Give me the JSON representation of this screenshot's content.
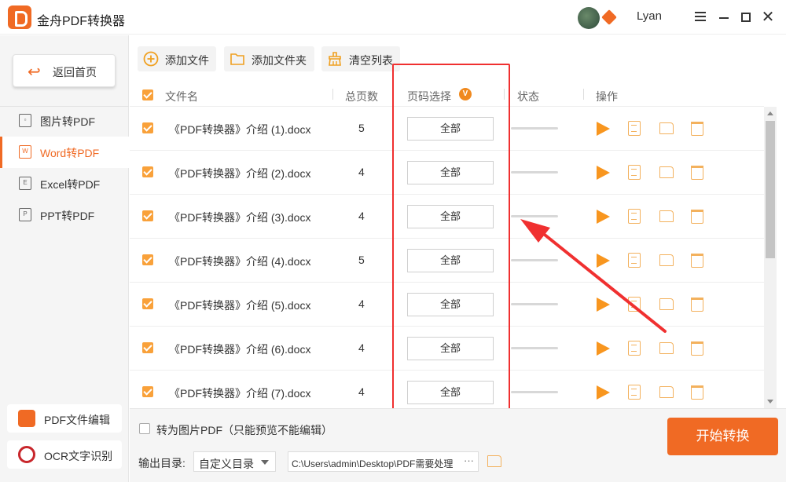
{
  "app": {
    "title": "金舟PDF转换器",
    "username": "Lyan",
    "accent_color": "#f06a24",
    "window_controls": [
      "menu-icon",
      "minimize-icon",
      "maximize-icon",
      "close-icon"
    ]
  },
  "sidebar": {
    "back_label": "返回首页",
    "items": [
      {
        "label": "图片转PDF",
        "icon": "image-file-icon",
        "icon_text": "",
        "active": false
      },
      {
        "label": "Word转PDF",
        "icon": "word-file-icon",
        "icon_text": "W",
        "active": true
      },
      {
        "label": "Excel转PDF",
        "icon": "excel-file-icon",
        "icon_text": "E",
        "active": false
      },
      {
        "label": "PPT转PDF",
        "icon": "ppt-file-icon",
        "icon_text": "P",
        "active": false
      }
    ],
    "tools": [
      {
        "label": "PDF文件编辑",
        "icon": "pdf-edit-icon"
      },
      {
        "label": "OCR文字识别",
        "icon": "ocr-eye-icon"
      }
    ]
  },
  "toolbar": {
    "add_file": "添加文件",
    "add_folder": "添加文件夹",
    "clear_list": "清空列表"
  },
  "table": {
    "headers": {
      "filename": "文件名",
      "pages": "总页数",
      "page_range": "页码选择",
      "page_range_badge": "V",
      "status": "状态",
      "actions": "操作"
    },
    "rows": [
      {
        "checked": true,
        "filename": "《PDF转换器》介绍 (1).docx",
        "pages": "5",
        "range": "全部"
      },
      {
        "checked": true,
        "filename": "《PDF转换器》介绍 (2).docx",
        "pages": "4",
        "range": "全部"
      },
      {
        "checked": true,
        "filename": "《PDF转换器》介绍 (3).docx",
        "pages": "4",
        "range": "全部"
      },
      {
        "checked": true,
        "filename": "《PDF转换器》介绍 (4).docx",
        "pages": "5",
        "range": "全部"
      },
      {
        "checked": true,
        "filename": "《PDF转换器》介绍 (5).docx",
        "pages": "4",
        "range": "全部"
      },
      {
        "checked": true,
        "filename": "《PDF转换器》介绍 (6).docx",
        "pages": "4",
        "range": "全部"
      },
      {
        "checked": true,
        "filename": "《PDF转换器》介绍 (7).docx",
        "pages": "4",
        "range": "全部"
      }
    ]
  },
  "bottom": {
    "convert_to_image_label": "转为图片PDF（只能预览不能编辑）",
    "convert_to_image_checked": false,
    "output_label": "输出目录:",
    "output_mode": "自定义目录",
    "output_path": "C:\\Users\\admin\\Desktop\\PDF需要处理",
    "path_more": "···",
    "start_label": "开始转换"
  },
  "annotation": {
    "highlight_color": "#f03030"
  }
}
